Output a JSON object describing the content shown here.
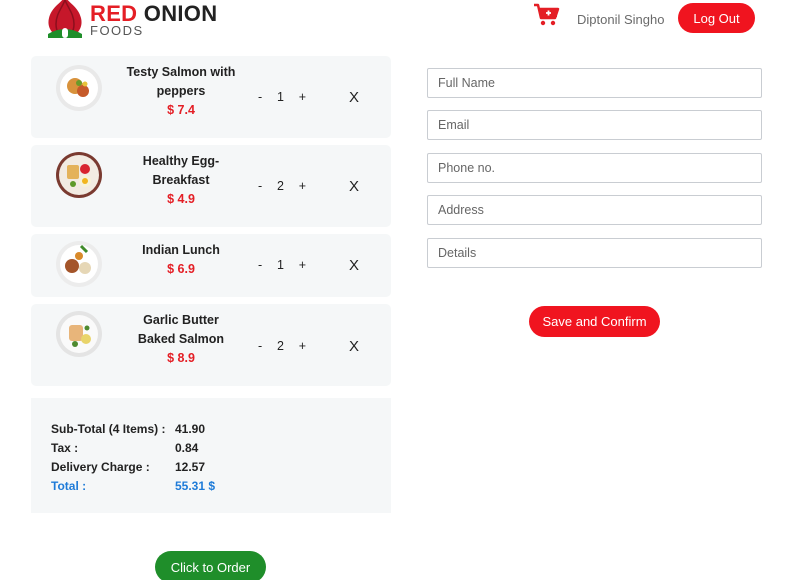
{
  "header": {
    "logo": {
      "word_red": "RED",
      "word_dark": "ONION",
      "subtitle": "FOODS"
    },
    "cart_icon": "shopping-cart-plus-icon",
    "user_name": "Diptonil Singho",
    "logout_label": "Log Out"
  },
  "cart": {
    "items": [
      {
        "name": "Testy Salmon with peppers",
        "price": "$ 7.4",
        "qty_minus": "-",
        "quantity": "1",
        "qty_plus": "+",
        "remove": "X",
        "image_icon": "food-plate-icon"
      },
      {
        "name": "Healthy Egg-Breakfast",
        "price": "$ 4.9",
        "qty_minus": "-",
        "quantity": "2",
        "qty_plus": "+",
        "remove": "X",
        "image_icon": "food-plate-icon"
      },
      {
        "name": "Indian Lunch",
        "price": "$ 6.9",
        "qty_minus": "-",
        "quantity": "1",
        "qty_plus": "+",
        "remove": "X",
        "image_icon": "food-plate-icon"
      },
      {
        "name": "Garlic Butter Baked Salmon",
        "price": "$ 8.9",
        "qty_minus": "-",
        "quantity": "2",
        "qty_plus": "+",
        "remove": "X",
        "image_icon": "food-plate-icon"
      }
    ]
  },
  "summary": {
    "subtotal_label": "Sub-Total (4 Items) :",
    "subtotal_value": "41.90",
    "tax_label": "Tax :",
    "tax_value": "0.84",
    "delivery_label": "Delivery Charge :",
    "delivery_value": "12.57",
    "total_label": "Total :",
    "total_value": "55.31 $"
  },
  "order_button_label": "Click to Order",
  "form": {
    "full_name_placeholder": "Full Name",
    "email_placeholder": "Email",
    "phone_placeholder": "Phone no.",
    "address_placeholder": "Address",
    "details_placeholder": "Details",
    "save_label": "Save and Confirm"
  },
  "colors": {
    "brand_red": "#f0141f",
    "price_red": "#e41e25",
    "total_blue": "#1e7bd8",
    "order_green": "#1f8e2a",
    "panel_bg": "#f5f7f8"
  }
}
